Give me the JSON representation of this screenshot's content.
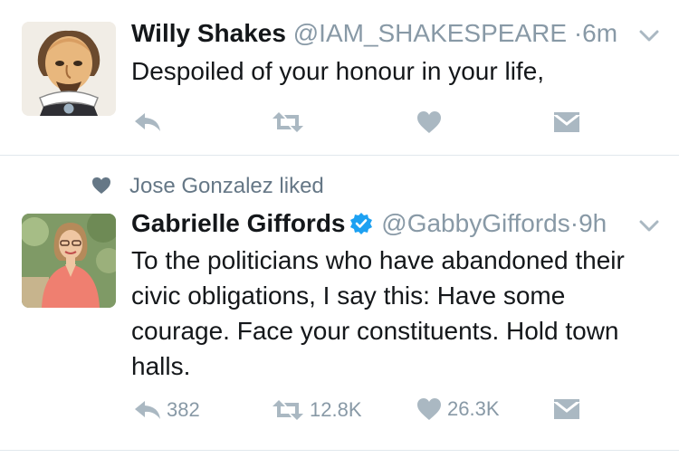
{
  "tweets": [
    {
      "name": "Willy Shakes",
      "handle": "@IAM_SHAKESPEARE",
      "separator": "·",
      "time": "6m",
      "text": "Despoiled of your honour in your life,",
      "actions": {
        "reply_count": "",
        "retweet_count": "",
        "like_count": ""
      }
    },
    {
      "social_context": "Jose Gonzalez liked",
      "name": "Gabrielle Giffords",
      "verified": true,
      "handle": "@GabbyGiffords",
      "separator": "·",
      "time": "9h",
      "text": "To the politicians who have abandoned their civic obligations, I say this: Have some courage. Face your constituents. Hold town halls.",
      "actions": {
        "reply_count": "382",
        "retweet_count": "12.8K",
        "like_count": "26.3K"
      }
    }
  ],
  "colors": {
    "icon_gray": "#aab8c2",
    "meta_gray": "#8899a6",
    "verified_blue": "#1da1f2",
    "text": "#14171a",
    "divider": "#e1e8ed"
  },
  "icons": [
    "reply-icon",
    "retweet-icon",
    "like-icon",
    "direct-message-icon",
    "chevron-down-icon",
    "verified-badge-icon",
    "heart-icon"
  ]
}
